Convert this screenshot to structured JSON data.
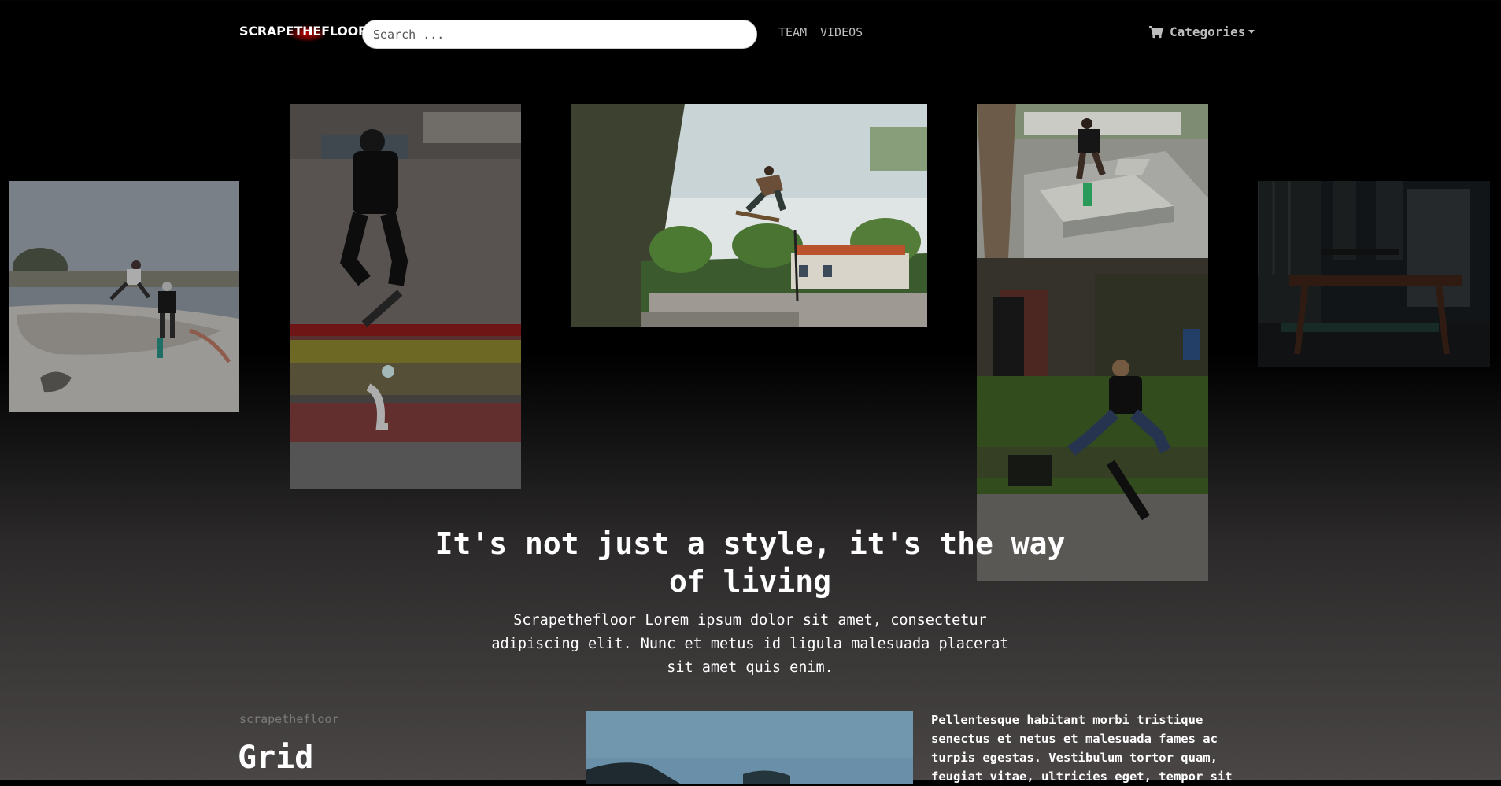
{
  "navbar": {
    "brand_left": "SCRAPE",
    "brand_mid": "THE",
    "brand_right": "FLOOR",
    "search_placeholder": "Search ...",
    "links": [
      "TEAM",
      "VIDEOS"
    ],
    "categories_label": "Categories",
    "cart_icon": "cart-icon"
  },
  "hero": {
    "title": "It's not just a style, it's the way of living",
    "subtitle": "Scrapethefloor Lorem ipsum dolor sit amet, consectetur adipiscing elit. Nunc et metus id ligula malesuada placerat sit amet quis enim."
  },
  "section": {
    "eyebrow": "scrapethefloor",
    "title": "Grid",
    "body": "Pellentesque habitant morbi tristique senectus et netus et malesuada fames ac turpis egestas. Vestibulum tortor quam, feugiat vitae, ultricies eget, tempor sit"
  },
  "colors": {
    "background_top": "#000000",
    "background_bottom": "#4a4646",
    "brand_glow": "#c80000",
    "nav_link": "#bdbdbd"
  }
}
